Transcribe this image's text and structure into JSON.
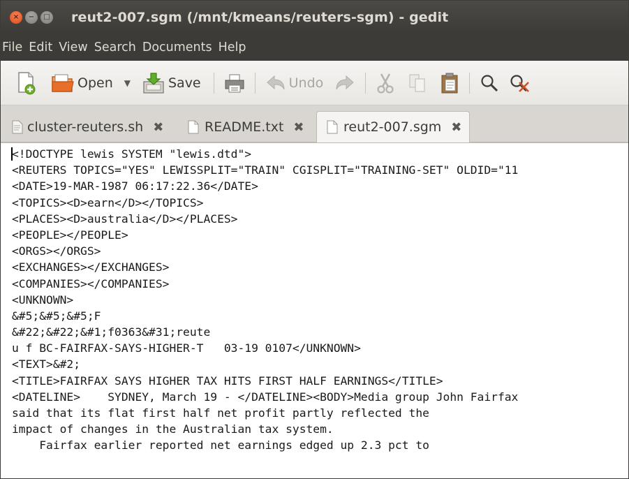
{
  "window": {
    "title": "reut2-007.sgm (/mnt/kmeans/reuters-sgm) - gedit",
    "buttons": {
      "close": "×",
      "minimize": "−",
      "maximize": "□"
    }
  },
  "menubar": {
    "items": [
      "File",
      "Edit",
      "View",
      "Search",
      "Documents",
      "Help"
    ]
  },
  "toolbar": {
    "open_label": "Open",
    "save_label": "Save",
    "undo_label": "Undo",
    "icons": [
      "new-document-icon",
      "open-folder-icon",
      "dropdown-arrow-icon",
      "save-icon",
      "print-icon",
      "undo-icon",
      "redo-icon",
      "cut-icon",
      "copy-icon",
      "paste-icon",
      "search-icon",
      "replace-icon"
    ]
  },
  "tabs": [
    {
      "label": "cluster-reuters.sh",
      "active": false
    },
    {
      "label": "README.txt",
      "active": false
    },
    {
      "label": "reut2-007.sgm",
      "active": true
    }
  ],
  "editor": {
    "lines": [
      "<!DOCTYPE lewis SYSTEM \"lewis.dtd\">",
      "<REUTERS TOPICS=\"YES\" LEWISSPLIT=\"TRAIN\" CGISPLIT=\"TRAINING-SET\" OLDID=\"11",
      "<DATE>19-MAR-1987 06:17:22.36</DATE>",
      "<TOPICS><D>earn</D></TOPICS>",
      "<PLACES><D>australia</D></PLACES>",
      "<PEOPLE></PEOPLE>",
      "<ORGS></ORGS>",
      "<EXCHANGES></EXCHANGES>",
      "<COMPANIES></COMPANIES>",
      "<UNKNOWN>",
      "&#5;&#5;&#5;F",
      "&#22;&#22;&#1;f0363&#31;reute",
      "u f BC-FAIRFAX-SAYS-HIGHER-T   03-19 0107</UNKNOWN>",
      "<TEXT>&#2;",
      "<TITLE>FAIRFAX SAYS HIGHER TAX HITS FIRST HALF EARNINGS</TITLE>",
      "<DATELINE>    SYDNEY, March 19 - </DATELINE><BODY>Media group John Fairfax",
      "said that its flat first half net profit partly reflected the",
      "impact of changes in the Australian tax system.",
      "    Fairfax earlier reported net earnings edged up 2.3 pct to"
    ]
  },
  "colors": {
    "titlebar": "#3c3b37",
    "close_button": "#df4b16",
    "title_text": "#dfdbd2",
    "toolbar_bg": "#f2f1f0",
    "editor_bg": "#ffffff"
  }
}
